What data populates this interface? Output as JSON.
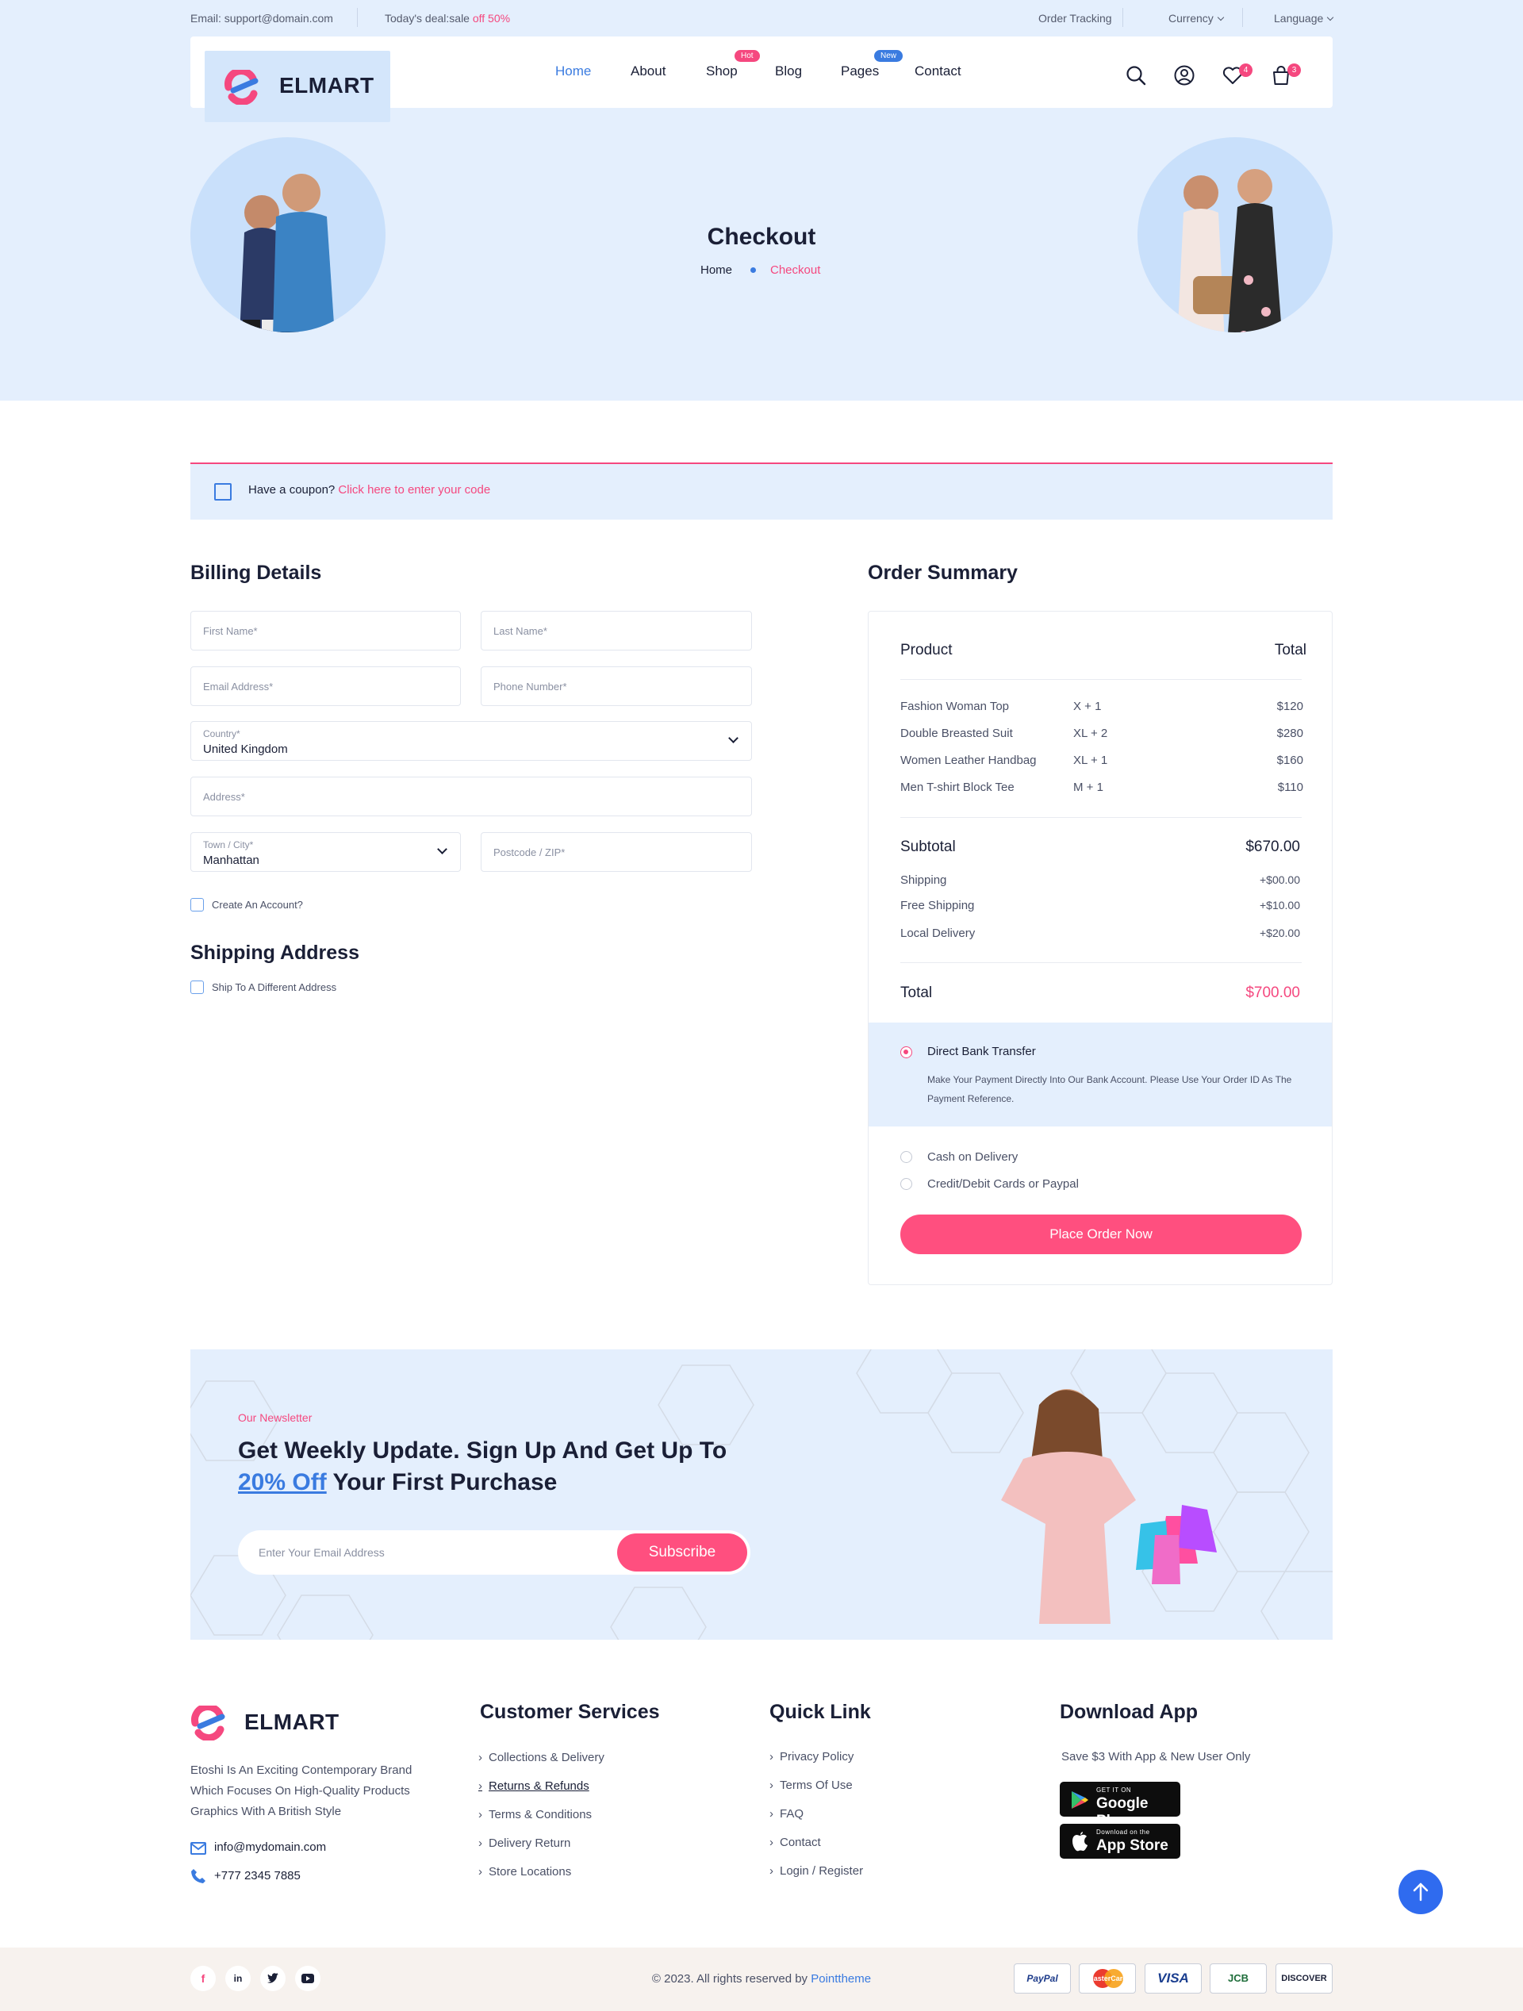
{
  "topbar": {
    "email": "Email: support@domain.com",
    "deal_prefix": "Today's deal:sale",
    "deal_off": "off 50%",
    "order_tracking": "Order Tracking",
    "currency": "Currency",
    "language": "Language"
  },
  "brand": {
    "name": "ELMART",
    "pink": "#f5487f",
    "blue": "#3a7be0"
  },
  "nav": {
    "items": [
      "Home",
      "About",
      "Shop",
      "Blog",
      "Pages",
      "Contact"
    ],
    "shop_badge": "Hot",
    "pages_badge": "New",
    "wishlist_count": "4",
    "cart_count": "3"
  },
  "hero": {
    "title": "Checkout",
    "crumb_home": "Home",
    "crumb_current": "Checkout"
  },
  "coupon": {
    "text": "Have a coupon?",
    "link": "Click here to enter your code"
  },
  "billing": {
    "title": "Billing Details",
    "first_name": "First Name*",
    "last_name": "Last Name*",
    "email": "Email Address*",
    "phone": "Phone Number*",
    "country_label": "Country*",
    "country_value": "United Kingdom",
    "address": "Address*",
    "city_label": "Town / City*",
    "city_value": "Manhattan",
    "postcode": "Postcode / ZIP*",
    "create_account": "Create An Account?"
  },
  "shipping": {
    "title": "Shipping Address",
    "different": "Ship To A Different Address"
  },
  "order": {
    "title": "Order Summary",
    "col_product": "Product",
    "col_total": "Total",
    "items": [
      {
        "name": "Fashion Woman Top",
        "qty": "X + 1",
        "price": "$120"
      },
      {
        "name": "Double Breasted Suit",
        "qty": "XL + 2",
        "price": "$280"
      },
      {
        "name": "Women Leather Handbag",
        "qty": "XL + 1",
        "price": "$160"
      },
      {
        "name": "Men T-shirt Block Tee",
        "qty": "M + 1",
        "price": "$110"
      }
    ],
    "subtotal_label": "Subtotal",
    "subtotal_value": "$670.00",
    "shipping_label": "Shipping",
    "shipping_value": "+$00.00",
    "free_label": "Free Shipping",
    "free_value": "+$10.00",
    "local_label": "Local Delivery",
    "local_value": "+$20.00",
    "total_label": "Total",
    "total_value": "$700.00",
    "pay_bank": "Direct Bank Transfer",
    "pay_bank_desc": "Make Your Payment Directly Into Our Bank Account. Please Use Your Order ID As The Payment Reference.",
    "pay_cod": "Cash on Delivery",
    "pay_card": "Credit/Debit Cards or Paypal",
    "place_order": "Place Order Now"
  },
  "newsletter": {
    "kicker": "Our Newsletter",
    "title_a": "Get Weekly Update. Sign Up And Get Up To",
    "title_off": "20% Off",
    "title_b": "Your First Purchase",
    "placeholder": "Enter Your Email Address",
    "button": "Subscribe"
  },
  "footer": {
    "about": "Etoshi Is An Exciting Contemporary Brand Which Focuses On High-Quality Products Graphics With A British Style",
    "email": "info@mydomain.com",
    "phone": "+777 2345 7885",
    "services_title": "Customer Services",
    "services": [
      "Collections & Delivery",
      "Returns & Refunds",
      "Terms & Conditions",
      "Delivery Return",
      "Store Locations"
    ],
    "quick_title": "Quick Link",
    "quick": [
      "Privacy Policy",
      "Terms Of Use",
      "FAQ",
      "Contact",
      "Login / Register"
    ],
    "app_title": "Download App",
    "app_text": "Save $3 With App & New User Only",
    "gplay_small": "GET IT ON",
    "gplay_big": "Google Play",
    "appstore_small": "Download on the",
    "appstore_big": "App Store",
    "copyright": "© 2023. All rights reserved by",
    "copyright_brand": "Pointtheme",
    "social": [
      "f",
      "in",
      "t",
      "yt"
    ],
    "payments": [
      "PayPal",
      "MasterCard",
      "VISA",
      "JCB",
      "DISCOVER"
    ]
  }
}
